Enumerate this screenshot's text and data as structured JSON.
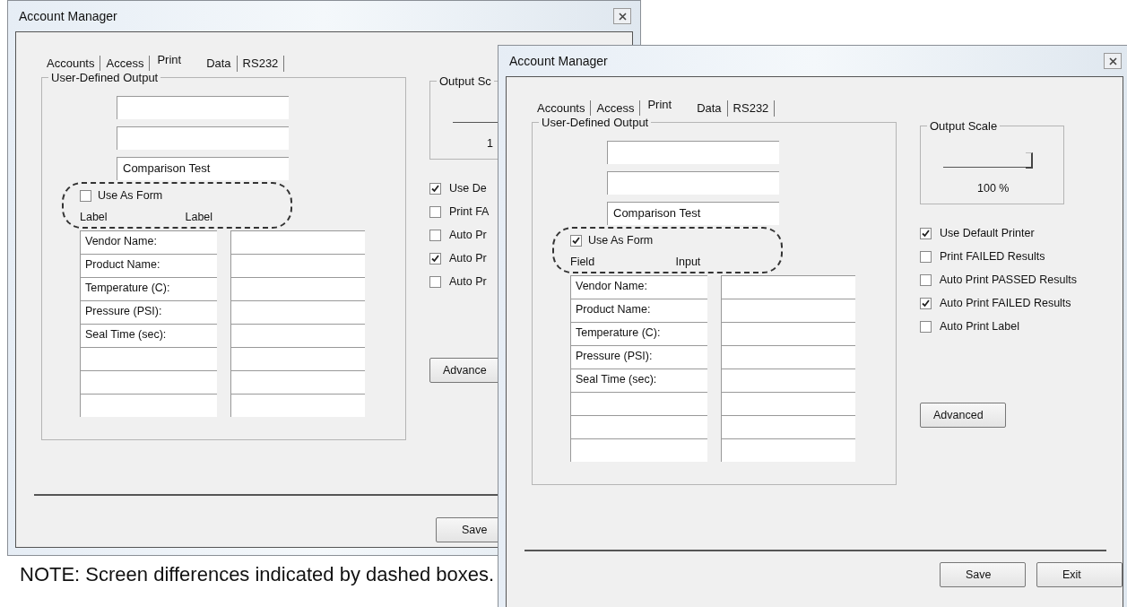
{
  "windows": [
    {
      "title": "Account Manager",
      "tabs": [
        {
          "label": "Accounts",
          "selected": false
        },
        {
          "label": "Access",
          "selected": false
        },
        {
          "label": "Print",
          "selected": true
        },
        {
          "label": "Data",
          "selected": false
        },
        {
          "label": "RS232",
          "selected": false
        }
      ],
      "group_title": "User-Defined Output",
      "header_fields": [
        {
          "kind": "blank"
        },
        {
          "kind": "blank"
        },
        {
          "kind": "text",
          "value": "Comparison Test"
        }
      ],
      "use_as_form": {
        "label": "Use As Form",
        "checked": false
      },
      "columns": [
        "Label",
        "Label"
      ],
      "rows": [
        {
          "field": "Vendor Name:"
        },
        {
          "field": "Product Name:"
        },
        {
          "field": "Temperature (C):"
        },
        {
          "field": "Pressure (PSI):"
        },
        {
          "field": "Seal Time (sec):"
        },
        {},
        {},
        {}
      ],
      "output_scale": {
        "title": "Output Sc",
        "reading": "1"
      },
      "options": [
        {
          "label": "Use De",
          "checked": true
        },
        {
          "label": "Print FA",
          "checked": false
        },
        {
          "label": "Auto Pr",
          "checked": false
        },
        {
          "label": "Auto Pr",
          "checked": true
        },
        {
          "label": "Auto Pr",
          "checked": false
        }
      ],
      "advanced": "Advance",
      "buttons": [
        "Save"
      ]
    },
    {
      "title": "Account Manager",
      "tabs": [
        {
          "label": "Accounts",
          "selected": false
        },
        {
          "label": "Access",
          "selected": false
        },
        {
          "label": "Print",
          "selected": true
        },
        {
          "label": "Data",
          "selected": false
        },
        {
          "label": "RS232",
          "selected": false
        }
      ],
      "group_title": "User-Defined Output",
      "header_fields": [
        {
          "kind": "blank"
        },
        {
          "kind": "blank"
        },
        {
          "kind": "text",
          "value": "Comparison Test"
        }
      ],
      "use_as_form": {
        "label": "Use As Form",
        "checked": true
      },
      "columns": [
        "Field",
        "Input"
      ],
      "rows": [
        {
          "field": "Vendor Name:"
        },
        {
          "field": "Product Name:"
        },
        {
          "field": "Temperature (C):"
        },
        {
          "field": "Pressure (PSI):"
        },
        {
          "field": "Seal Time (sec):"
        },
        {},
        {},
        {}
      ],
      "output_scale": {
        "title": "Output Scale",
        "level": 1,
        "reading": "100 %"
      },
      "options": [
        {
          "label": "Use Default Printer",
          "checked": true
        },
        {
          "label": "Print FAILED Results",
          "checked": false
        },
        {
          "label": "Auto Print PASSED Results",
          "checked": false
        },
        {
          "label": "Auto Print FAILED Results",
          "checked": true
        },
        {
          "label": "Auto Print Label",
          "checked": false
        }
      ],
      "advanced": "Advanced",
      "buttons": [
        "Save",
        "Exit"
      ]
    }
  ],
  "note": "NOTE: Screen differences indicated by dashed boxes."
}
